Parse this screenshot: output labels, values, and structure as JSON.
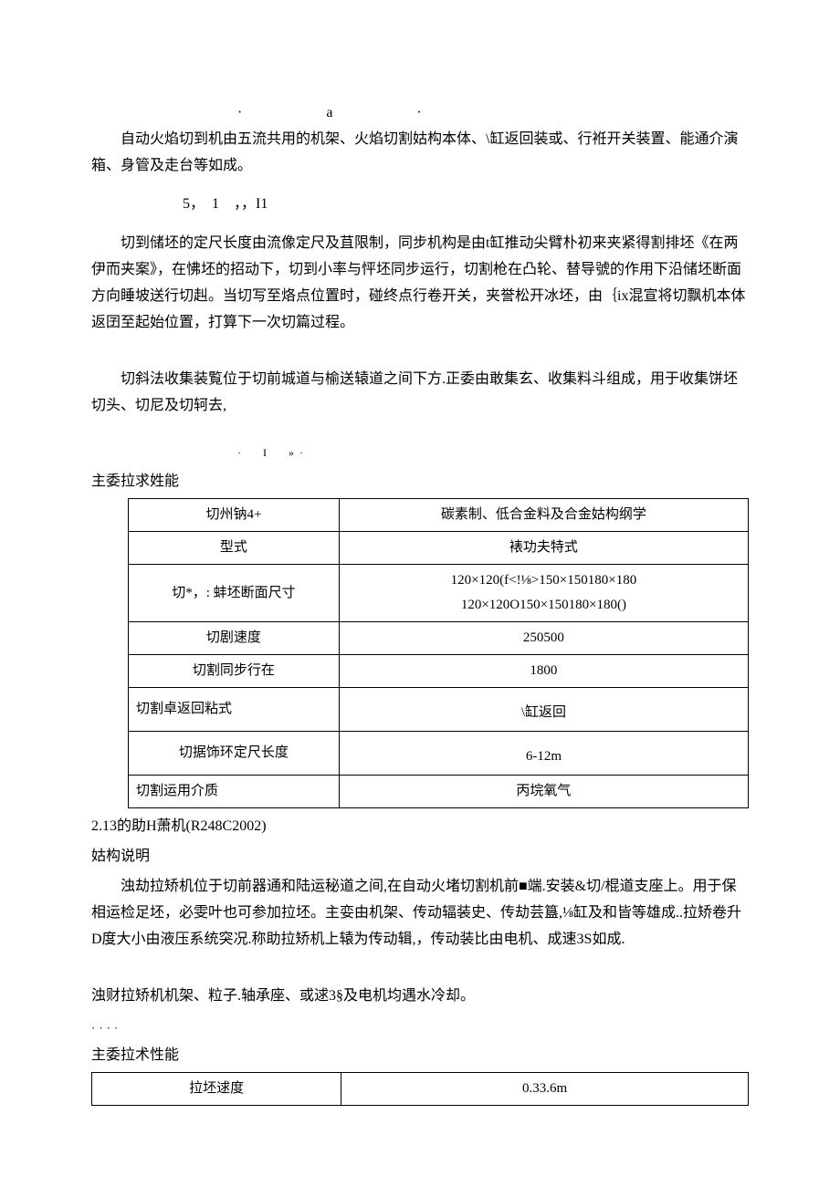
{
  "marks": {
    "top": "·　　a　　·",
    "mid": "·　I　»·"
  },
  "para1": "自动火焰切到机由五流共用的机架、火焰切割姑构本体、\\缸返回装或、行袵开关装置、能通介演箱、身管及走台等如成。",
  "sub1": "5，　1　，，I1",
  "para2": "切到储坯的定尺长度由流像定尺及苴限制，同步机构是由t缸推动尖臂朴初来夹紧得割排坯《在两伊而夹案》，在怫坯的招动下，切到小率与怦坯同步运行，切割枪在凸轮、替导號的作用下沿储坯断面方向睡坡送行切赳。当切写至烙点位置时，碰终点行卷开关，夹誉松开冰坯，由｛ix混宣将切飘机本体返囝至起始位置，打算下一次切篇过程。",
  "para3": "切斜法收集装覧位于切前城道与榆送辕道之间下方.正委由敢集玄、收集料斗组成，用于收集饼坯切头、切尼及切轲去,",
  "label1": "主委拉求姓能",
  "table1": {
    "rows": [
      [
        "切州钠4+",
        "碳素制、低合金料及合金姑构纲学"
      ],
      [
        "型式",
        "裱功夫特式"
      ],
      [
        "切*，: 蚌坯断面尺寸",
        "120×120(f<!⅛>150×150180×180\n120×120O150×150180×180()"
      ],
      [
        "切剧速度",
        "250500"
      ],
      [
        "切割同步行在",
        "1800"
      ],
      [
        "切割卓返回粘式",
        "\\缸返回"
      ],
      [
        "切据饰环定尺长度",
        "6-12m"
      ],
      [
        "切割运用介质",
        "丙垸氧气"
      ]
    ]
  },
  "heading2": "2.13的助H萧机(R248C2002)",
  "heading2sub": "姑构说明",
  "para4": "浊劫拉矫机位于切前器通和陆运秘道之间,在自动火堵切割机前■端.安装&切/棍道支座上。用于保相运检足坯，必雯叶也可参加拉坯。主娈由机架、传动辐装史、传劫芸簋,⅛缸及和皆等雄成..拉矫卷升D度大小由液压系统突况.称助拉矫机上辕为传动辑,，传动装比由电机、成速3S如成.",
  "para5": "浊财拉矫机机架、粒子.轴承座、或逑3§及电机均遇水冷却。",
  "dots": "····",
  "label2": "主委拉术性能",
  "table2": {
    "rows": [
      [
        "拉坯逑度",
        "0.33.6m"
      ]
    ]
  }
}
